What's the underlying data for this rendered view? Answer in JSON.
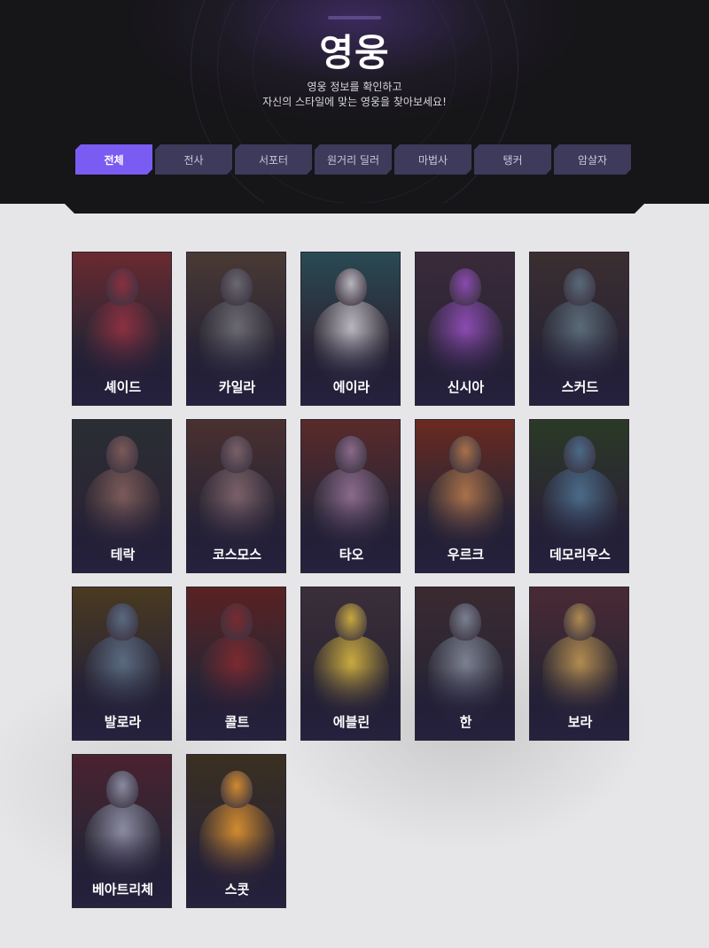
{
  "header": {
    "title": "영웅",
    "subtitle_line1": "영웅 정보를 확인하고",
    "subtitle_line2": "자신의 스타일에 맞는 영웅을 찾아보세요!"
  },
  "tabs": [
    {
      "label": "전체",
      "active": true
    },
    {
      "label": "전사",
      "active": false
    },
    {
      "label": "서포터",
      "active": false
    },
    {
      "label": "원거리 딜러",
      "active": false
    },
    {
      "label": "마법사",
      "active": false
    },
    {
      "label": "탱커",
      "active": false
    },
    {
      "label": "암살자",
      "active": false
    }
  ],
  "heroes": [
    {
      "name": "셰이드",
      "tint": "#6a2a30",
      "accent": "#8a3040"
    },
    {
      "name": "카일라",
      "tint": "#4a3a34",
      "accent": "#6a6870"
    },
    {
      "name": "에이라",
      "tint": "#2a4a54",
      "accent": "#b8b4bc"
    },
    {
      "name": "신시아",
      "tint": "#3a2a3a",
      "accent": "#8a4ab0"
    },
    {
      "name": "스커드",
      "tint": "#3a2e30",
      "accent": "#5a6a78"
    },
    {
      "name": "테락",
      "tint": "#2a2e34",
      "accent": "#7a5a58"
    },
    {
      "name": "코스모스",
      "tint": "#4a3030",
      "accent": "#7a6068"
    },
    {
      "name": "타오",
      "tint": "#5a2a2a",
      "accent": "#8a6a8a"
    },
    {
      "name": "우르크",
      "tint": "#6a2a20",
      "accent": "#a8704a"
    },
    {
      "name": "데모리우스",
      "tint": "#2a3a26",
      "accent": "#4a6a88"
    },
    {
      "name": "발로라",
      "tint": "#4a3a20",
      "accent": "#5a6a80"
    },
    {
      "name": "콜트",
      "tint": "#5a2222",
      "accent": "#7a2a30"
    },
    {
      "name": "에블린",
      "tint": "#3a2e3a",
      "accent": "#c8a840"
    },
    {
      "name": "한",
      "tint": "#3a2a30",
      "accent": "#7a8090"
    },
    {
      "name": "보라",
      "tint": "#4a2a34",
      "accent": "#b08a50"
    },
    {
      "name": "베아트리체",
      "tint": "#4a2230",
      "accent": "#8a8aa0"
    },
    {
      "name": "스콧",
      "tint": "#3a3020",
      "accent": "#d08a30"
    }
  ]
}
